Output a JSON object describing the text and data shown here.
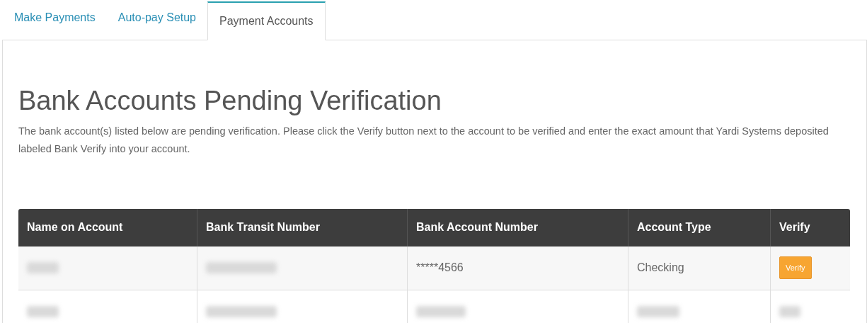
{
  "tabs": [
    {
      "label": "Make Payments",
      "selected": false
    },
    {
      "label": "Auto-pay Setup",
      "selected": false
    },
    {
      "label": "Payment Accounts",
      "selected": true
    }
  ],
  "heading": "Bank Accounts Pending Verification",
  "description": "The bank account(s) listed below are pending verification. Please click the Verify button next to the account to be verified and enter the exact amount that Yardi Systems deposited labeled Bank Verify into your account.",
  "table": {
    "columns": [
      "Name on Account",
      "Bank Transit Number",
      "Bank Account Number",
      "Account Type",
      "Verify"
    ],
    "rows": [
      [
        {
          "kind": "redacted"
        },
        {
          "kind": "redacted"
        },
        {
          "kind": "text",
          "text": "*****4566"
        },
        {
          "kind": "text",
          "text": "Checking"
        },
        {
          "kind": "button",
          "text": "Verify"
        }
      ],
      [
        {
          "kind": "redacted"
        },
        {
          "kind": "redacted"
        },
        {
          "kind": "redacted"
        },
        {
          "kind": "redacted"
        },
        {
          "kind": "redacted"
        }
      ]
    ]
  }
}
